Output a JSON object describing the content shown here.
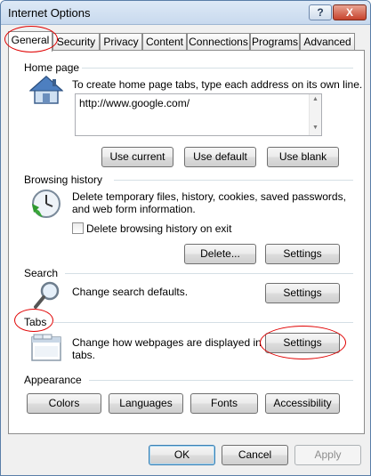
{
  "window": {
    "title": "Internet Options",
    "help_label": "?",
    "close_label": "X"
  },
  "tabs": [
    {
      "label": "General"
    },
    {
      "label": "Security"
    },
    {
      "label": "Privacy"
    },
    {
      "label": "Content"
    },
    {
      "label": "Connections"
    },
    {
      "label": "Programs"
    },
    {
      "label": "Advanced"
    }
  ],
  "home_page": {
    "label": "Home page",
    "description": "To create home page tabs, type each address on its own line.",
    "url": "http://www.google.com/",
    "use_current": "Use current",
    "use_default": "Use default",
    "use_blank": "Use blank"
  },
  "browsing_history": {
    "label": "Browsing history",
    "description_line1": "Delete temporary files, history, cookies, saved passwords,",
    "description_line2": "and web form information.",
    "checkbox_label": "Delete browsing history on exit",
    "delete_label": "Delete...",
    "settings_label": "Settings"
  },
  "search": {
    "label": "Search",
    "description": "Change search defaults.",
    "settings_label": "Settings"
  },
  "tabs_section": {
    "label": "Tabs",
    "description_line1": "Change how webpages are displayed in",
    "description_line2": "tabs.",
    "settings_label": "Settings"
  },
  "appearance": {
    "label": "Appearance",
    "colors": "Colors",
    "languages": "Languages",
    "fonts": "Fonts",
    "accessibility": "Accessibility"
  },
  "footer": {
    "ok": "OK",
    "cancel": "Cancel",
    "apply": "Apply"
  },
  "colors": {
    "highlight": "#e00000",
    "accent": "#3c7fb1"
  }
}
